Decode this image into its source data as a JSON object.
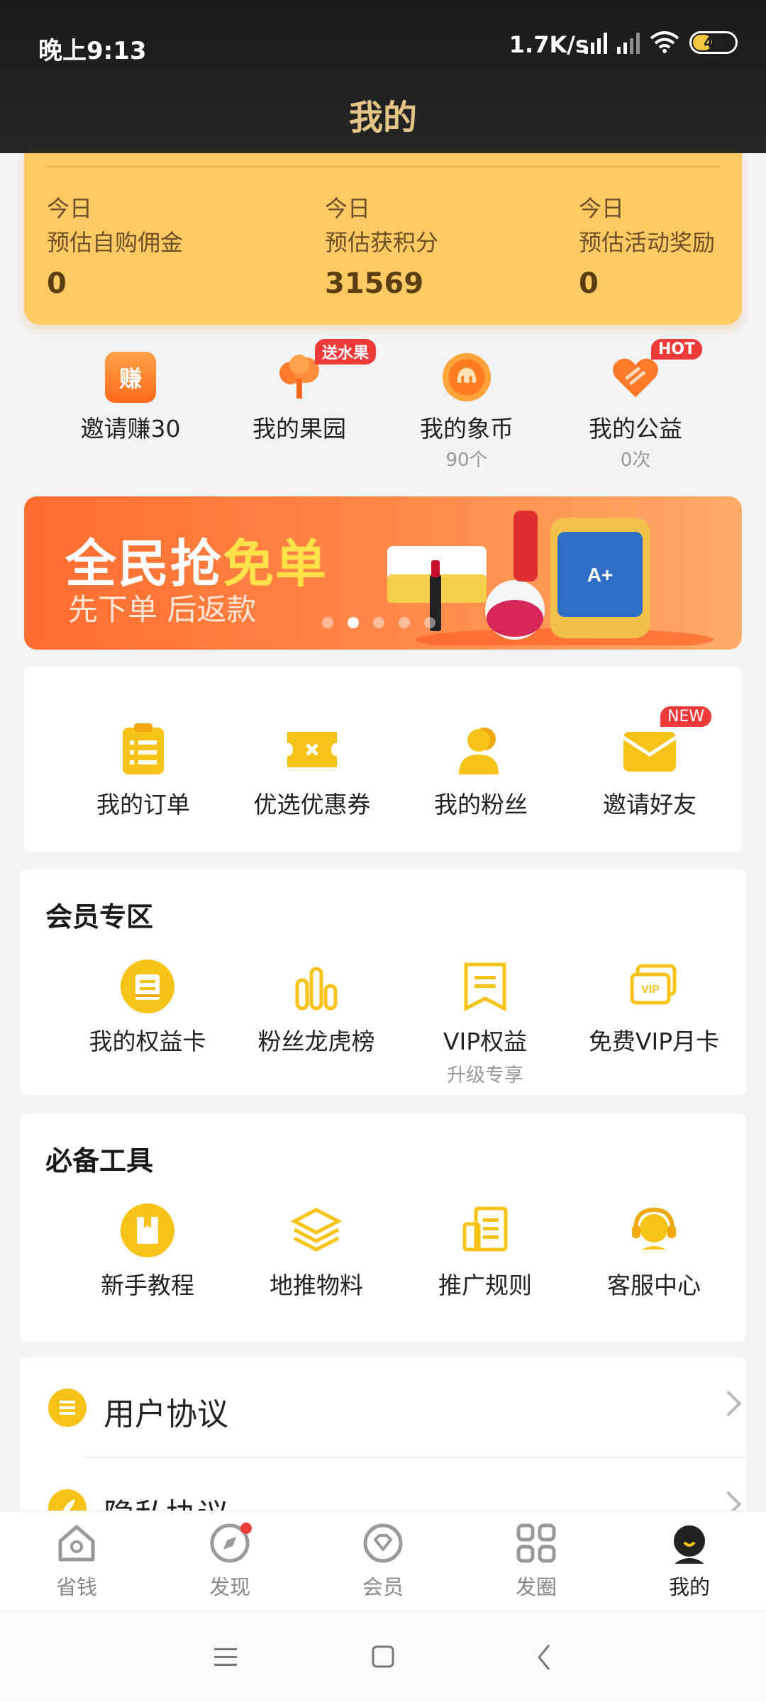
{
  "status_bar": {
    "time": "晚上9:13",
    "speed": "1.7K/s",
    "battery": "46"
  },
  "header": {
    "title": "我的"
  },
  "stats": [
    {
      "period": "今日",
      "label": "预估自购佣金",
      "value": "0"
    },
    {
      "period": "今日",
      "label": "预估获积分",
      "value": "31569"
    },
    {
      "period": "今日",
      "label": "预估活动奖励",
      "value": "0"
    }
  ],
  "quick_actions": [
    {
      "label": "邀请赚30",
      "icon_text": "赚"
    },
    {
      "label": "我的果园",
      "badge": "送水果"
    },
    {
      "label": "我的象币",
      "sub": "90个"
    },
    {
      "label": "我的公益",
      "sub": "0次",
      "badge": "HOT"
    }
  ],
  "banner": {
    "title_part1": "全民抢",
    "title_part2": "免单",
    "subtitle": "先下单 后返款",
    "active_dot": 1
  },
  "main_grid": [
    {
      "label": "我的订单"
    },
    {
      "label": "优选优惠券"
    },
    {
      "label": "我的粉丝"
    },
    {
      "label": "邀请好友",
      "badge": "NEW"
    }
  ],
  "member_section": {
    "title": "会员专区",
    "items": [
      {
        "label": "我的权益卡"
      },
      {
        "label": "粉丝龙虎榜"
      },
      {
        "label": "VIP权益",
        "sub": "升级专享"
      },
      {
        "label": "免费VIP月卡",
        "icon_text": "VIP"
      }
    ]
  },
  "tools_section": {
    "title": "必备工具",
    "items": [
      {
        "label": "新手教程"
      },
      {
        "label": "地推物料"
      },
      {
        "label": "推广规则"
      },
      {
        "label": "客服中心"
      }
    ]
  },
  "list": [
    {
      "label": "用户协议"
    },
    {
      "label": "隐私协议"
    }
  ],
  "tabbar": [
    {
      "label": "省钱"
    },
    {
      "label": "发现"
    },
    {
      "label": "会员"
    },
    {
      "label": "发圈"
    },
    {
      "label": "我的"
    }
  ],
  "colors": {
    "accent": "#f7c318",
    "card_yellow": "#ffc964",
    "banner": "#ff6d2f",
    "badge_red": "#ef3a3a",
    "title_gold": "#e5c585"
  }
}
